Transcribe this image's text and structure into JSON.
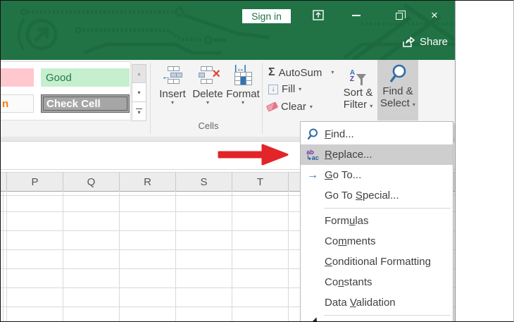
{
  "titlebar": {
    "sign_in": "Sign in",
    "share": "Share",
    "close_glyph": "×"
  },
  "ribbon": {
    "style_gallery": {
      "bad_cell_label": "",
      "good_cell_label": "Good",
      "calc_cell_label": "n",
      "check_cell_label": "Check Cell"
    },
    "cells_group": {
      "label": "Cells",
      "insert": "Insert",
      "delete": "Delete",
      "format": "Format"
    },
    "editing_group": {
      "autosum": "AutoSum",
      "fill": "Fill",
      "clear": "Clear",
      "sort_filter_line1": "Sort &",
      "sort_filter_line2": "Filter",
      "find_select_line1": "Find &",
      "find_select_line2": "Select"
    }
  },
  "menu": {
    "items": [
      {
        "pre": "",
        "key": "F",
        "suf": "ind...",
        "icon": "find-icon"
      },
      {
        "pre": "",
        "key": "R",
        "suf": "eplace...",
        "icon": "replace-icon",
        "highlighted": true
      },
      {
        "pre": "",
        "key": "G",
        "suf": "o To...",
        "icon": "goto-icon"
      },
      {
        "pre": "Go To ",
        "key": "S",
        "suf": "pecial...",
        "icon": "none"
      },
      {
        "pre": "Form",
        "key": "u",
        "suf": "las",
        "icon": "none"
      },
      {
        "pre": "Co",
        "key": "m",
        "suf": "ments",
        "icon": "none"
      },
      {
        "pre": "",
        "key": "C",
        "suf": "onditional Formatting",
        "icon": "none"
      },
      {
        "pre": "Co",
        "key": "n",
        "suf": "stants",
        "icon": "none"
      },
      {
        "pre": "Data ",
        "key": "V",
        "suf": "alidation",
        "icon": "none"
      }
    ]
  },
  "sheet": {
    "columns": [
      "P",
      "Q",
      "R",
      "S",
      "T"
    ]
  },
  "icons": {
    "caret": "▾",
    "sigma": "Σ",
    "fill_arrow": "↓",
    "insert_arrow": "←",
    "delete_x": "×",
    "format_arrow": "|↔|",
    "sort_a": "A",
    "sort_z": "Z",
    "goto_arrow": "→",
    "replace_top": "ab",
    "replace_bottom": "↳ac",
    "gallery_up": "▴",
    "gallery_down": "▾"
  },
  "colors": {
    "excel_green": "#217346",
    "pattern_green": "#1e6a40",
    "accent_blue": "#2b579a",
    "accent_purple": "#7030a0",
    "annotation_red": "#e32428",
    "menu_highlight": "#cecece",
    "good_bg": "#c6efce",
    "bad_bg": "#ffc7ce",
    "check_bg": "#a6a6a6",
    "calc_orange": "#fa7d00"
  }
}
